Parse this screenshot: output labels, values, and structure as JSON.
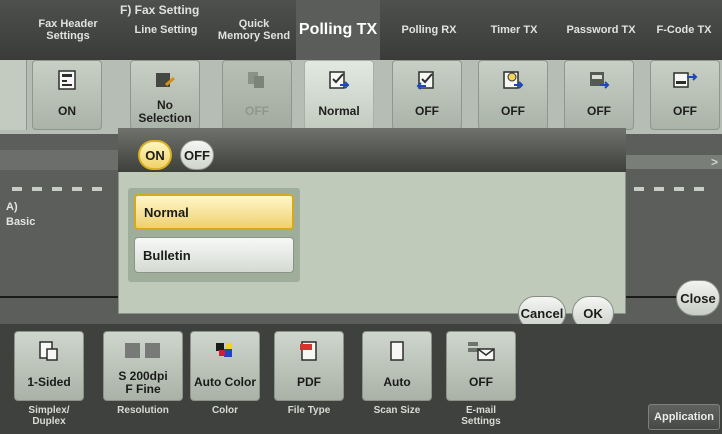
{
  "header": {
    "section_title": "F)  Fax Setting",
    "tabs": [
      {
        "label": "Fax Header\nSettings"
      },
      {
        "label": "Line Setting"
      },
      {
        "label": "Quick\nMemory Send"
      },
      {
        "label": "Polling TX"
      },
      {
        "label": "Polling RX"
      },
      {
        "label": "Timer TX"
      },
      {
        "label": "Password TX"
      },
      {
        "label": "F-Code TX"
      }
    ]
  },
  "cards": [
    {
      "value": "ON",
      "icon": "fax-header-icon"
    },
    {
      "value": "No\nSelection",
      "icon": "line-setting-icon"
    },
    {
      "value": "OFF",
      "icon": "quick-memory-icon"
    },
    {
      "value": "Normal",
      "icon": "polling-tx-icon"
    },
    {
      "value": "OFF",
      "icon": "polling-rx-icon"
    },
    {
      "value": "OFF",
      "icon": "timer-tx-icon"
    },
    {
      "value": "OFF",
      "icon": "password-tx-icon"
    },
    {
      "value": "OFF",
      "icon": "fcode-tx-icon"
    }
  ],
  "side": {
    "label_a": "A)",
    "label_basic": "Basic",
    "close": "Close"
  },
  "modal": {
    "toggle_on": "ON",
    "toggle_off": "OFF",
    "options": [
      "Normal",
      "Bulletin"
    ],
    "cancel": "Cancel",
    "ok": "OK"
  },
  "bottom": {
    "items": [
      {
        "value": "1-Sided",
        "label": "Simplex/\nDuplex",
        "icon": "simplex-icon"
      },
      {
        "value": "S 200dpi\nF Fine",
        "label": "Resolution",
        "icon": "resolution-icon"
      },
      {
        "value": "Auto Color",
        "label": "Color",
        "icon": "color-icon"
      },
      {
        "value": "PDF",
        "label": "File Type",
        "icon": "pdf-icon"
      },
      {
        "value": "Auto",
        "label": "Scan Size",
        "icon": "page-icon"
      },
      {
        "value": "OFF",
        "label": "E-mail\nSettings",
        "icon": "email-icon"
      }
    ],
    "application": "Application"
  },
  "colors": {
    "accent_selected": "#f1d26a",
    "selected_border": "#d5a91c",
    "icon_blue": "#2047b8"
  }
}
